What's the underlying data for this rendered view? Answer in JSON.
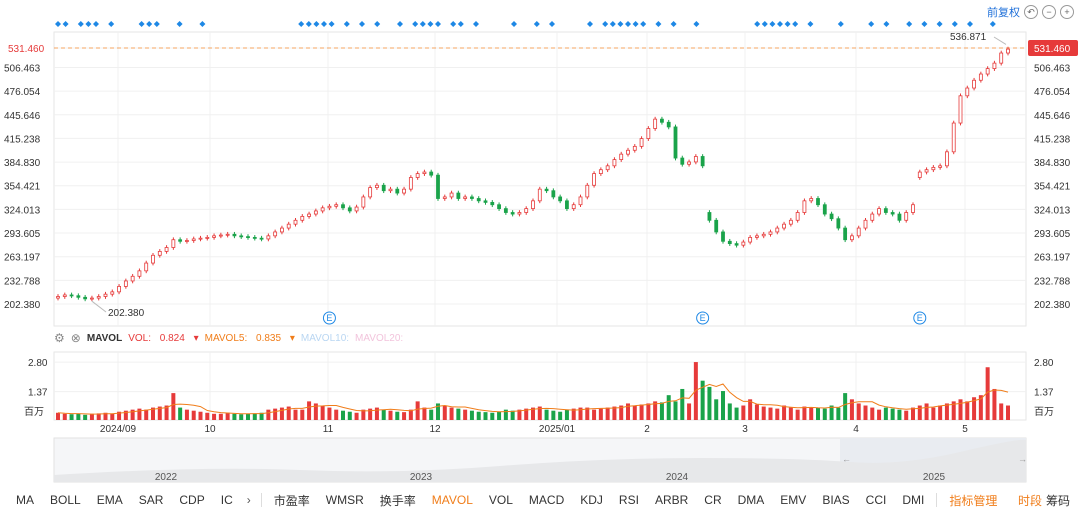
{
  "toolbar": {
    "adjust_label": "前复权",
    "icons": [
      "undo-icon",
      "zoom-out-icon",
      "zoom-in-icon"
    ]
  },
  "price_axis": {
    "ticks": [
      "531.460",
      "506.463",
      "476.054",
      "445.646",
      "415.238",
      "384.830",
      "354.421",
      "324.013",
      "293.605",
      "263.197",
      "232.788",
      "202.380"
    ],
    "current_price": "531.460",
    "high_label": "536.871",
    "low_label": "202.380"
  },
  "volume_axis": {
    "ticks": [
      "2.80",
      "1.37"
    ],
    "unit": "百万"
  },
  "volume_header": {
    "name": "MAVOL",
    "vol_label": "VOL:",
    "vol_value": "0.824",
    "mavol5_label": "MAVOL5:",
    "mavol5_value": "0.835",
    "mavol10_label": "MAVOL10:",
    "mavol20_label": "MAVOL20:"
  },
  "time_axis": {
    "labels": [
      "2024/09",
      "10",
      "11",
      "12",
      "2025/01",
      "2",
      "3",
      "4",
      "5"
    ]
  },
  "navigator": {
    "years": [
      "2022",
      "2023",
      "2024",
      "2025"
    ]
  },
  "event_marker": "E",
  "indicators": [
    "MA",
    "BOLL",
    "EMA",
    "SAR",
    "CDP",
    "IC"
  ],
  "indicators2": [
    "市盈率",
    "WMSR",
    "换手率",
    "MAVOL",
    "VOL",
    "MACD",
    "KDJ",
    "RSI",
    "ARBR",
    "CR",
    "DMA",
    "EMV",
    "BIAS",
    "CCI",
    "DMI"
  ],
  "indicator_manage": "指标管理",
  "right_tabs": {
    "time": "时段",
    "chips": "筹码"
  },
  "colors": {
    "up": "#e63a3a",
    "down": "#1aa34a",
    "price_line": "#f4a460",
    "dot": "#1e88e5",
    "ma5": "#f07d1a"
  },
  "chart_data": {
    "type": "candlestick",
    "ylim": [
      202.38,
      536.871
    ],
    "open": [
      210,
      212,
      214,
      213,
      211,
      209,
      210,
      212,
      215,
      218,
      225,
      232,
      238,
      245,
      255,
      265,
      270,
      275,
      285,
      283,
      284,
      286,
      287,
      288,
      290,
      291,
      292,
      290,
      289,
      288,
      287,
      286,
      290,
      295,
      300,
      305,
      310,
      315,
      318,
      322,
      326,
      328,
      330,
      326,
      322,
      327,
      340,
      352,
      355,
      348,
      350,
      345,
      350,
      365,
      370,
      372,
      368,
      338,
      340,
      345,
      338,
      340,
      338,
      335,
      333,
      330,
      325,
      320,
      318,
      320,
      325,
      335,
      350,
      348,
      340,
      335,
      325,
      330,
      340,
      355,
      370,
      375,
      380,
      388,
      395,
      400,
      405,
      415,
      428,
      440,
      436,
      430,
      390,
      382,
      385,
      392,
      320,
      310,
      295,
      283,
      280,
      278,
      282,
      288,
      290,
      292,
      295,
      300,
      305,
      310,
      320,
      335,
      338,
      330,
      318,
      312,
      300,
      285,
      290,
      300,
      310,
      318,
      325,
      320,
      318,
      310,
      320,
      365,
      372,
      375,
      378,
      380,
      398,
      435,
      470,
      480,
      490,
      498,
      505,
      512,
      525
    ],
    "close": [
      212,
      214,
      213,
      211,
      209,
      210,
      212,
      215,
      218,
      225,
      232,
      238,
      245,
      255,
      265,
      270,
      275,
      285,
      283,
      284,
      286,
      287,
      288,
      290,
      291,
      292,
      290,
      289,
      288,
      287,
      286,
      290,
      295,
      300,
      305,
      310,
      315,
      318,
      322,
      326,
      328,
      330,
      326,
      322,
      327,
      340,
      352,
      355,
      348,
      350,
      345,
      350,
      365,
      370,
      372,
      368,
      338,
      340,
      345,
      338,
      340,
      338,
      335,
      333,
      330,
      325,
      320,
      318,
      320,
      325,
      335,
      350,
      348,
      340,
      335,
      325,
      330,
      340,
      355,
      370,
      375,
      380,
      388,
      395,
      400,
      405,
      415,
      428,
      440,
      436,
      430,
      390,
      382,
      385,
      392,
      380,
      310,
      295,
      283,
      280,
      278,
      282,
      288,
      290,
      292,
      295,
      300,
      305,
      310,
      320,
      335,
      338,
      330,
      318,
      312,
      300,
      285,
      290,
      300,
      310,
      318,
      325,
      320,
      318,
      310,
      320,
      330,
      372,
      375,
      378,
      380,
      398,
      435,
      470,
      480,
      490,
      498,
      505,
      512,
      525,
      530
    ],
    "volume": [
      0.35,
      0.3,
      0.28,
      0.3,
      0.25,
      0.3,
      0.32,
      0.35,
      0.3,
      0.4,
      0.45,
      0.5,
      0.55,
      0.5,
      0.6,
      0.65,
      0.7,
      1.3,
      0.6,
      0.5,
      0.45,
      0.4,
      0.35,
      0.3,
      0.3,
      0.35,
      0.3,
      0.28,
      0.3,
      0.32,
      0.35,
      0.5,
      0.55,
      0.6,
      0.65,
      0.5,
      0.5,
      0.9,
      0.8,
      0.7,
      0.6,
      0.5,
      0.45,
      0.4,
      0.35,
      0.5,
      0.55,
      0.6,
      0.5,
      0.45,
      0.4,
      0.38,
      0.5,
      0.9,
      0.6,
      0.5,
      0.8,
      0.7,
      0.6,
      0.55,
      0.5,
      0.45,
      0.4,
      0.38,
      0.35,
      0.4,
      0.5,
      0.45,
      0.5,
      0.55,
      0.6,
      0.65,
      0.5,
      0.45,
      0.4,
      0.5,
      0.55,
      0.6,
      0.6,
      0.5,
      0.55,
      0.6,
      0.65,
      0.7,
      0.8,
      0.7,
      0.75,
      0.8,
      0.9,
      0.85,
      1.2,
      0.9,
      1.5,
      0.8,
      2.8,
      1.9,
      1.6,
      1.0,
      1.4,
      0.8,
      0.6,
      0.7,
      1.0,
      0.75,
      0.65,
      0.6,
      0.55,
      0.7,
      0.6,
      0.5,
      0.65,
      0.6,
      0.6,
      0.55,
      0.7,
      0.6,
      1.3,
      1.0,
      0.8,
      0.7,
      0.6,
      0.5,
      0.6,
      0.55,
      0.5,
      0.45,
      0.6,
      0.7,
      0.8,
      0.6,
      0.7,
      0.8,
      0.9,
      1.0,
      0.9,
      1.1,
      1.2,
      2.55,
      1.5,
      0.8,
      0.7,
      0.6
    ],
    "volume_ylim": [
      0,
      2.9
    ],
    "time_labels": [
      "2024/09",
      "10",
      "11",
      "12",
      "2025/01",
      "2",
      "3",
      "4",
      "5"
    ],
    "events_at": [
      40,
      95,
      127
    ]
  }
}
